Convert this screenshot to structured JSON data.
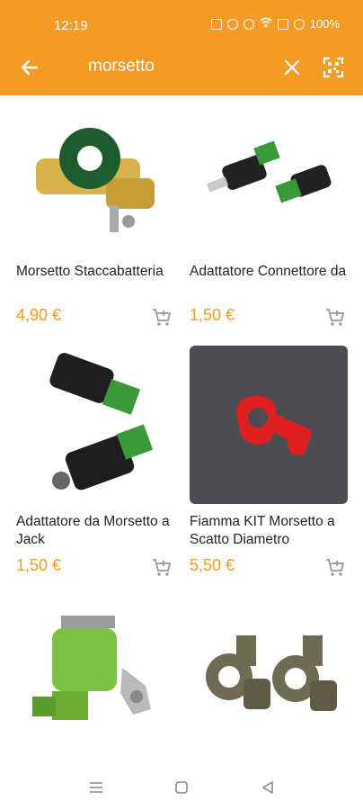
{
  "status": {
    "time": "12:19",
    "battery": "100%"
  },
  "search": {
    "query": "morsetto"
  },
  "icons": {
    "back": "arrow-left-icon",
    "clear": "close-icon",
    "scan": "qr-scan-icon",
    "cart": "add-to-cart-icon"
  },
  "colors": {
    "accent": "#f59a23",
    "text": "#222222"
  },
  "products": [
    {
      "title": "Morsetto Staccabatteria",
      "price": "4,90 €"
    },
    {
      "title": "Adattatore Connettore da",
      "price": "1,50 €"
    },
    {
      "title": "Adattatore da Morsetto a Jack",
      "price": "1,50 €"
    },
    {
      "title": "Fiamma KIT Morsetto a Scatto Diametro",
      "price": "5,50 €"
    },
    {
      "title": "",
      "price": ""
    },
    {
      "title": "",
      "price": ""
    }
  ]
}
